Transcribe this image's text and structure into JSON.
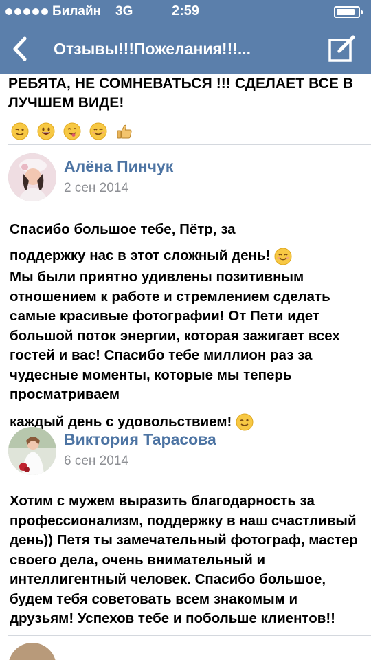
{
  "status_bar": {
    "carrier": "Билайн",
    "network": "3G",
    "time": "2:59",
    "battery_level": 0.85
  },
  "navbar": {
    "title": "Отзывы!!!Пожелания!!!...",
    "back_icon": "chevron-left-icon",
    "compose_icon": "compose-icon"
  },
  "colors": {
    "navbar_bg": "#5b7fab",
    "author_link": "#4d74a3",
    "date_gray": "#8d8f94",
    "divider": "#d4d8de"
  },
  "previous_comment": {
    "text": "РЕБЯТА, НЕ СОМНЕВАТЬСЯ !!! СДЕЛАЕТ ВСЕ В ЛУЧШЕМ ВИДЕ!",
    "emojis": [
      "wink-emoji",
      "grin-emoji",
      "tongue-emoji",
      "smile-emoji",
      "thumbs-up-emoji"
    ]
  },
  "comments": [
    {
      "author": "Алёна Пинчук",
      "date": "2 сен 2014",
      "line1": "Спасибо большое тебе, Пётр, за",
      "line2": "поддержку нас в этот сложный день!",
      "line2_emoji": "smile-emoji",
      "paragraph": "Мы были приятно удивлены позитивным отношением к работе и стремлением сделать самые красивые фотографии! От Пети идет большой поток энергии, которая зажигает всех гостей и вас! Спасибо тебе миллион раз за чудесные моменты, которые мы теперь просматриваем",
      "last_line": "каждый день с удовольствием!",
      "last_emoji": "wink-emoji"
    },
    {
      "author": "Виктория Тарасова",
      "date": "6 сен 2014",
      "text": "Хотим с мужем выразить благодарность за профессионализм, поддержку в наш счастливый день)) Петя ты замечательный фотограф, мастер своего дела, очень внимательный и интеллигентный человек. Спасибо большое, будем тебя советовать всем знакомым и друзьям! Успехов тебе и побольше клиентов!!"
    }
  ]
}
